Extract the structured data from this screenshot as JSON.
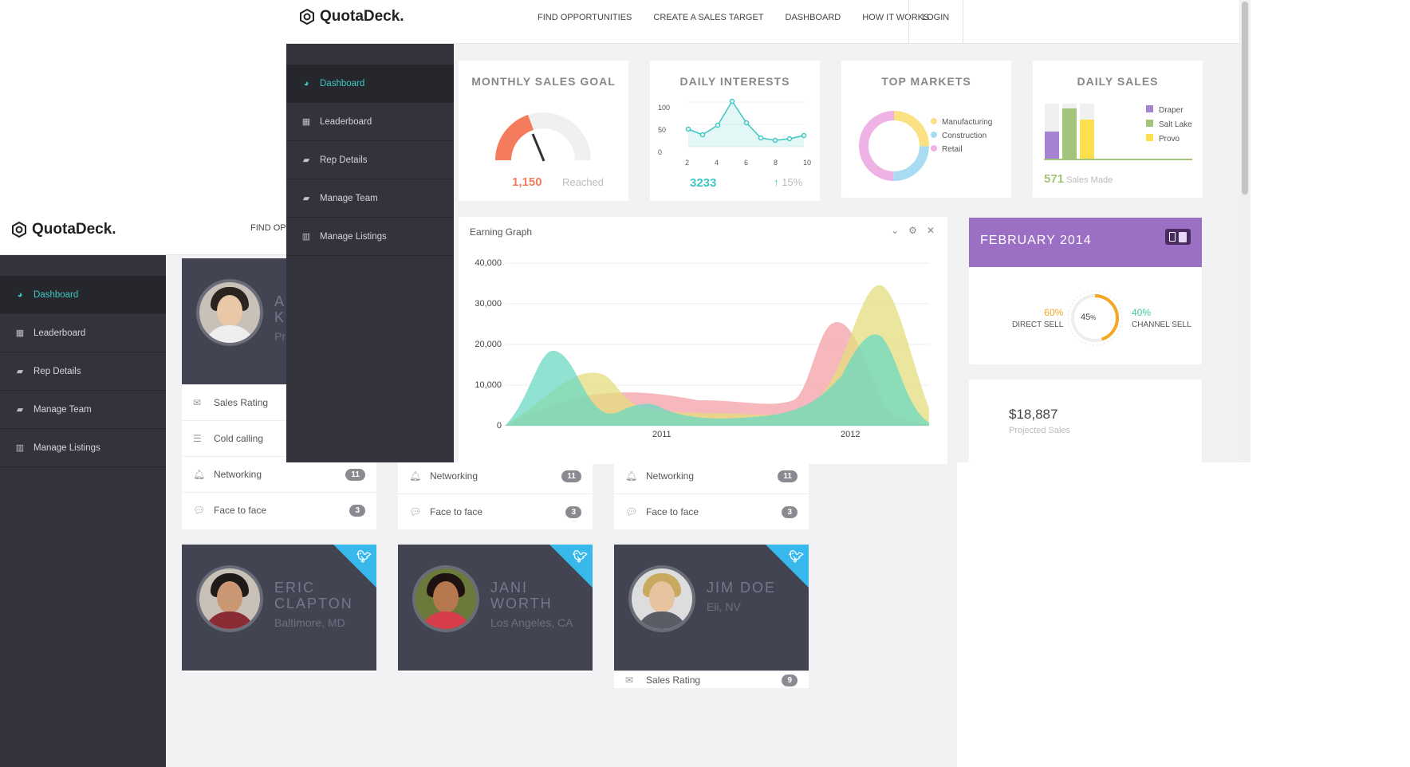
{
  "brand": "QuotaDeck.",
  "back_window": {
    "nav_partial": "FIND OPP",
    "sidebar": [
      "Dashboard",
      "Leaderboard",
      "Rep Details",
      "Manage Team",
      "Manage Listings"
    ],
    "cards": [
      {
        "name_partial": "A\nK",
        "loc_partial": "Pr",
        "rows": [
          {
            "label": "Sales Rating"
          },
          {
            "label": "Cold calling"
          },
          {
            "label": "Networking",
            "count": "11"
          },
          {
            "label": "Face to face",
            "count": "3"
          }
        ]
      },
      {
        "rows": [
          {
            "label": "Networking",
            "count": "11"
          },
          {
            "label": "Face to face",
            "count": "3"
          }
        ]
      },
      {
        "rows": [
          {
            "label": "Networking",
            "count": "11"
          },
          {
            "label": "Face to face",
            "count": "3"
          }
        ]
      }
    ],
    "profiles": [
      {
        "first": "ERIC",
        "last": "CLAPTON",
        "loc": "Baltimore, MD"
      },
      {
        "first": "JANI",
        "last": "WORTH",
        "loc": "Los Angeles, CA"
      },
      {
        "first": "JIM DOE",
        "last": "",
        "loc": "Eli, NV",
        "row": {
          "label": "Sales Rating",
          "count": "9"
        }
      }
    ]
  },
  "front_window": {
    "nav": [
      "FIND OPPORTUNITIES",
      "CREATE A SALES TARGET",
      "DASHBOARD",
      "HOW IT WORKS"
    ],
    "login": "LOGIN",
    "sidebar": [
      "Dashboard",
      "Leaderboard",
      "Rep Details",
      "Manage Team",
      "Manage Listings"
    ],
    "monthly": {
      "title": "MONTHLY SALES GOAL",
      "value": "1,150",
      "label": "Reached"
    },
    "interests": {
      "title": "DAILY INTERESTS",
      "value": "3233",
      "pct": "15%",
      "yticks": [
        "100",
        "50",
        "0"
      ],
      "xticks": [
        "2",
        "4",
        "6",
        "8",
        "10"
      ]
    },
    "markets": {
      "title": "TOP MARKETS",
      "legend": [
        "Manufacturing",
        "Construction",
        "Retail"
      ]
    },
    "daily": {
      "title": "DAILY SALES",
      "legend": [
        "Draper",
        "Salt Lake",
        "Provo"
      ],
      "value": "571",
      "label": "Sales Made"
    },
    "earning": {
      "title": "Earning Graph",
      "yticks": [
        "40,000",
        "30,000",
        "20,000",
        "10,000",
        "0"
      ],
      "xticks": [
        "2011",
        "2012"
      ]
    },
    "feb": {
      "title": "FEBRUARY 2014",
      "left_pct": "60%",
      "left_label": "DIRECT SELL",
      "center": "45",
      "right_pct": "40%",
      "right_label": "CHANNEL SELL"
    },
    "projected": {
      "value": "$18,887",
      "label": "Projected Sales"
    }
  },
  "colors": {
    "accent": "#3ec7c2",
    "sidebar": "#32333b",
    "purple": "#9b6fc3",
    "orange": "#f47c5c"
  }
}
